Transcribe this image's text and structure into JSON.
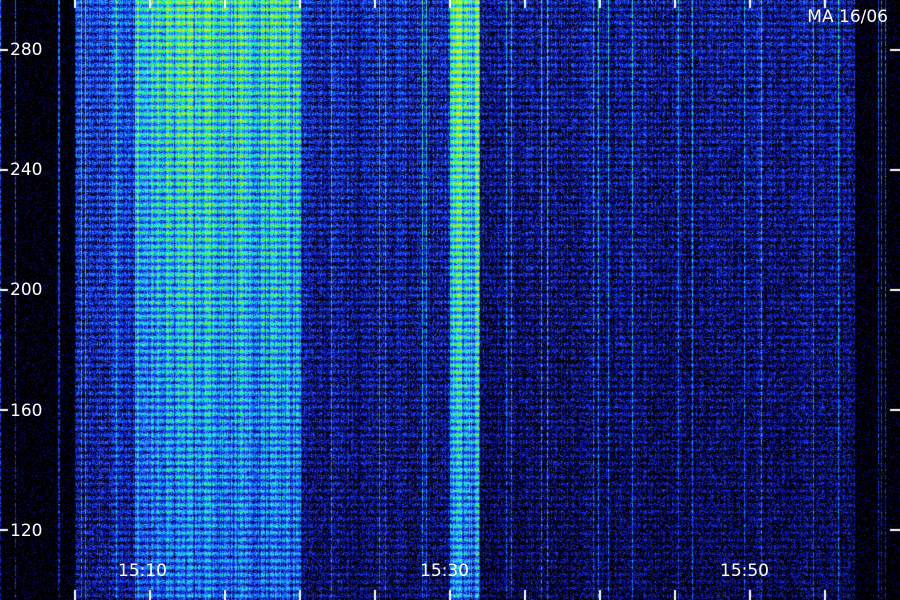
{
  "chart_data": {
    "type": "heatmap",
    "title": "",
    "xlabel": "",
    "ylabel": "",
    "annotation": "MA 16/06",
    "y_ticks": [
      {
        "value": 280,
        "label": "280"
      },
      {
        "value": 240,
        "label": "240"
      },
      {
        "value": 200,
        "label": "200"
      },
      {
        "value": 160,
        "label": "160"
      },
      {
        "value": 120,
        "label": "120"
      }
    ],
    "x_ticks": [
      {
        "value": "15:10",
        "label": "15:10"
      },
      {
        "value": "15:30",
        "label": "15:30"
      },
      {
        "value": "15:50",
        "label": "15:50"
      }
    ],
    "xlim": [
      "15:05",
      "15:57"
    ],
    "ylim": [
      115,
      290
    ],
    "colormap": [
      "#000000",
      "#0a0a6e",
      "#1e3cff",
      "#1e9bff",
      "#28f0e6",
      "#3cf03c",
      "#c8f028"
    ],
    "intensity_bands": [
      {
        "start": "15:05",
        "end": "15:09",
        "level": 0.45
      },
      {
        "start": "15:09",
        "end": "15:20",
        "level": 0.85
      },
      {
        "start": "15:20",
        "end": "15:28",
        "level": 0.35
      },
      {
        "start": "15:28",
        "end": "15:30",
        "level": 0.35
      },
      {
        "start": "15:30",
        "end": "15:32",
        "level": 1.0
      },
      {
        "start": "15:32",
        "end": "15:57",
        "level": 0.28
      }
    ],
    "grid": false
  }
}
